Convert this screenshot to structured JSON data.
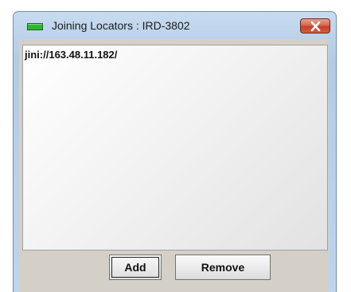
{
  "window": {
    "title": "Joining Locators : IRD-3802",
    "close_icon": "close-x-icon",
    "indicator_color": "#2fb82f"
  },
  "locators": {
    "items": [
      {
        "prefix": "jini://",
        "address": "163.48.11.182/"
      }
    ]
  },
  "buttons": {
    "add_label": "Add",
    "remove_label": "Remove"
  }
}
